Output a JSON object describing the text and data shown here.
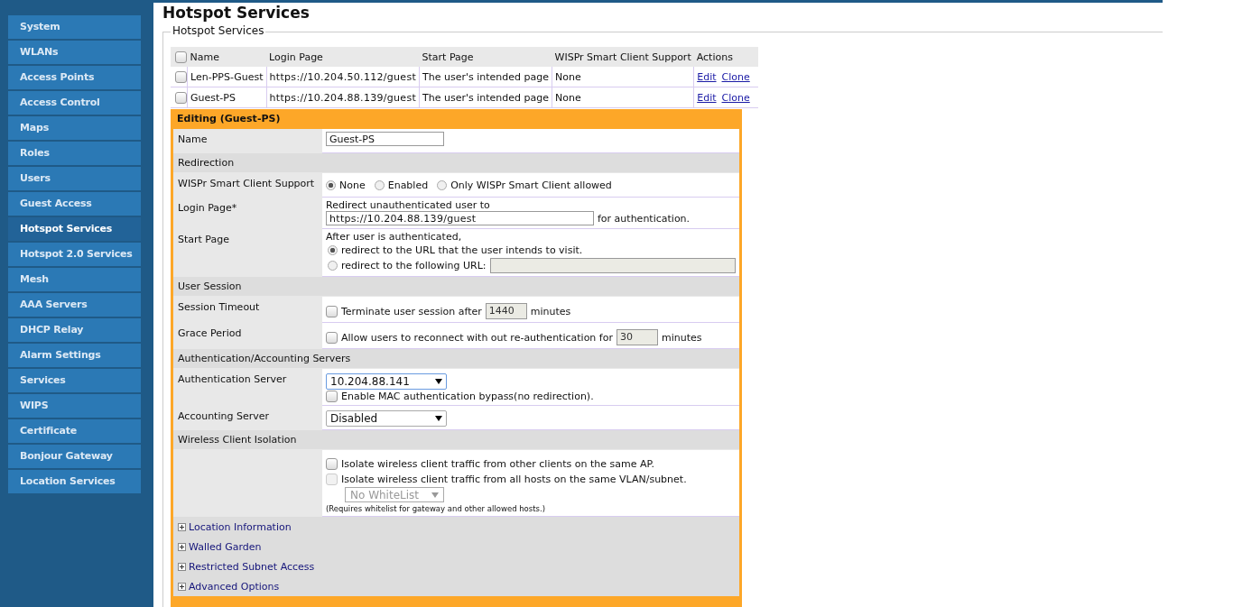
{
  "sidebar": {
    "items": [
      {
        "label": "System",
        "selected": false
      },
      {
        "label": "WLANs",
        "selected": false
      },
      {
        "label": "Access Points",
        "selected": false
      },
      {
        "label": "Access Control",
        "selected": false
      },
      {
        "label": "Maps",
        "selected": false
      },
      {
        "label": "Roles",
        "selected": false
      },
      {
        "label": "Users",
        "selected": false
      },
      {
        "label": "Guest Access",
        "selected": false
      },
      {
        "label": "Hotspot Services",
        "selected": true
      },
      {
        "label": "Hotspot 2.0 Services",
        "selected": false
      },
      {
        "label": "Mesh",
        "selected": false
      },
      {
        "label": "AAA Servers",
        "selected": false
      },
      {
        "label": "DHCP Relay",
        "selected": false
      },
      {
        "label": "Alarm Settings",
        "selected": false
      },
      {
        "label": "Services",
        "selected": false
      },
      {
        "label": "WIPS",
        "selected": false
      },
      {
        "label": "Certificate",
        "selected": false
      },
      {
        "label": "Bonjour Gateway",
        "selected": false
      },
      {
        "label": "Location Services",
        "selected": false
      }
    ]
  },
  "page": {
    "title": "Hotspot Services",
    "legend": "Hotspot Services"
  },
  "table": {
    "header_checked": false,
    "columns": [
      "Name",
      "Login Page",
      "Start Page",
      "WISPr Smart Client Support",
      "Actions"
    ],
    "rows": [
      {
        "checked": false,
        "cells": [
          "Len-PPS-Guest",
          "https://10.204.50.112/guest",
          "The user's intended page",
          "None"
        ],
        "actions": [
          "Edit",
          "Clone"
        ]
      },
      {
        "checked": false,
        "cells": [
          "Guest-PS",
          "https://10.204.88.139/guest",
          "The user's intended page",
          "None"
        ],
        "actions": [
          "Edit",
          "Clone"
        ]
      }
    ]
  },
  "editor": {
    "title": "Editing (Guest-PS)",
    "rows": [
      {
        "kind": "text",
        "label": "Name",
        "value": "Guest-PS"
      },
      {
        "kind": "section",
        "label": "Redirection"
      },
      {
        "kind": "radios",
        "label": "WISPr Smart Client Support",
        "options": [
          {
            "label": "None",
            "selected": true
          },
          {
            "label": "Enabled",
            "selected": false
          },
          {
            "label": "Only WISPr Smart Client allowed",
            "selected": false
          }
        ]
      },
      {
        "kind": "login",
        "label": "Login Page*",
        "intro": "Redirect unauthenticated user to",
        "value": "https://10.204.88.139/guest",
        "suffix": "for authentication."
      },
      {
        "kind": "start",
        "label": "Start Page",
        "intro": "After user is authenticated,",
        "options": [
          {
            "kind": "plain",
            "label": "redirect to the URL that the user intends to visit.",
            "selected": true
          },
          {
            "kind": "url",
            "label": "redirect to the following URL:",
            "selected": false
          }
        ]
      },
      {
        "kind": "section",
        "label": "User Session"
      },
      {
        "kind": "minutes",
        "label": "Session Timeout",
        "checked": false,
        "before": "Terminate user session after",
        "value": "1440",
        "after": "minutes"
      },
      {
        "kind": "minutes",
        "label": "Grace Period",
        "checked": false,
        "before": "Allow users to reconnect with out re-authentication for",
        "value": "30",
        "after": "minutes"
      },
      {
        "kind": "section",
        "label": "Authentication/Accounting Servers"
      },
      {
        "kind": "select",
        "label": "Authentication Server",
        "value": "10.204.88.141",
        "focused": true,
        "option": {
          "label": "Enable MAC authentication bypass(no redirection).",
          "checked": false
        }
      },
      {
        "kind": "select",
        "label": "Accounting Server",
        "value": "Disabled",
        "focused": false
      },
      {
        "kind": "section",
        "label": "Wireless Client Isolation"
      },
      {
        "kind": "isolation",
        "options": [
          {
            "label": "Isolate wireless client traffic from other clients on the same AP.",
            "checked": false,
            "disabled": false
          },
          {
            "label": "Isolate wireless client traffic from all hosts on the same VLAN/subnet.",
            "checked": false,
            "disabled": true
          }
        ],
        "whitelist": "No WhiteList",
        "note": "(Requires whitelist for gateway and other allowed hosts.)"
      },
      {
        "kind": "expander",
        "label": "Location Information"
      },
      {
        "kind": "expander",
        "label": "Walled Garden"
      },
      {
        "kind": "expander",
        "label": "Restricted Subnet Access"
      },
      {
        "kind": "expander",
        "label": "Advanced Options"
      }
    ]
  }
}
